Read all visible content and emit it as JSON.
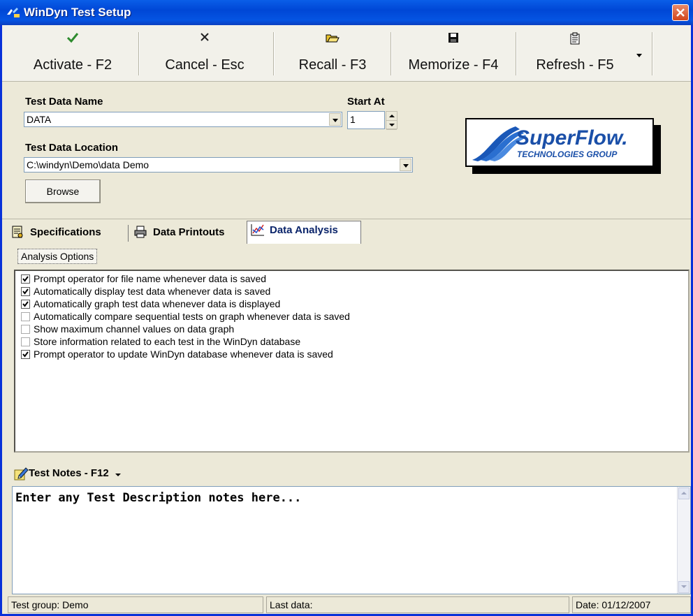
{
  "window": {
    "title": "WinDyn Test Setup"
  },
  "toolbar": {
    "buttons": [
      {
        "label": "Activate - F2",
        "icon": "checkmark-icon"
      },
      {
        "label": "Cancel - Esc",
        "icon": "x-icon"
      },
      {
        "label": "Recall - F3",
        "icon": "open-folder-icon"
      },
      {
        "label": "Memorize - F4",
        "icon": "floppy-disk-icon"
      },
      {
        "label": "Refresh - F5",
        "icon": "clipboard-icon"
      }
    ]
  },
  "form": {
    "test_data_name_label": "Test Data Name",
    "test_data_name_value": "DATA",
    "start_at_label": "Start At",
    "start_at_value": "1",
    "test_data_location_label": "Test Data Location",
    "test_data_location_value": "C:\\windyn\\Demo\\data Demo",
    "browse_label": "Browse",
    "logo_text": "SuperFlow. TECHNOLOGIES GROUP"
  },
  "tabs": [
    {
      "label": "Specifications",
      "active": false
    },
    {
      "label": "Data Printouts",
      "active": false
    },
    {
      "label": "Data Analysis",
      "active": true
    }
  ],
  "analysis": {
    "group_label": "Analysis Options",
    "options": [
      {
        "label": "Prompt operator for file name whenever data is saved",
        "checked": true
      },
      {
        "label": "Automatically display test data whenever data is saved",
        "checked": true
      },
      {
        "label": "Automatically graph test data whenever data is displayed",
        "checked": true
      },
      {
        "label": "Automatically compare sequential tests on graph whenever data is saved",
        "checked": false
      },
      {
        "label": "Show maximum channel values on data graph",
        "checked": false
      },
      {
        "label": "Store information related to each test in the WinDyn database",
        "checked": false
      },
      {
        "label": "Prompt operator to update WinDyn database whenever data is saved",
        "checked": true
      }
    ]
  },
  "notes": {
    "title": "Test Notes - F12",
    "text": "Enter any Test Description notes here..."
  },
  "status": {
    "group": "Test group: Demo",
    "last_data": "Last data:",
    "date": "Date: 01/12/2007"
  },
  "colors": {
    "titlebar": "#0554e2",
    "window_bg": "#ece9d8",
    "close": "#d3451c",
    "checkmark": "#2e8b2e"
  }
}
